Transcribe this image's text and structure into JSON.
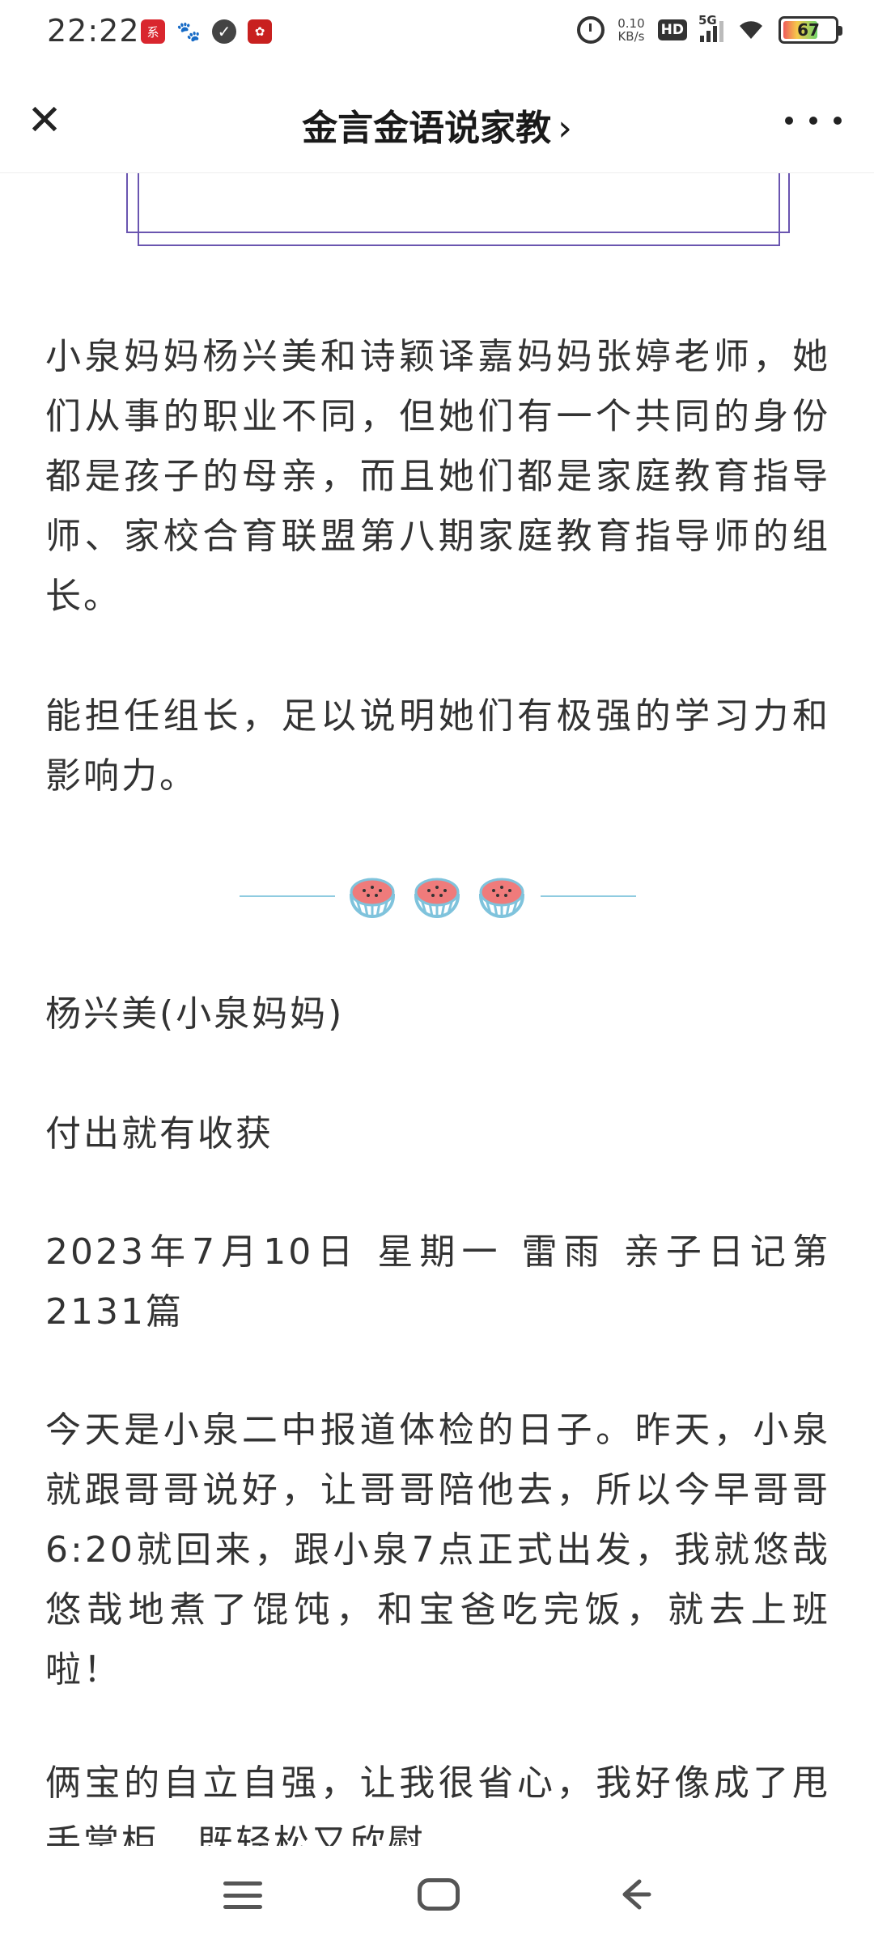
{
  "status_bar": {
    "time": "22:22",
    "app_icons": [
      {
        "name": "news-app-icon",
        "glyph": "系"
      },
      {
        "name": "baidu-icon",
        "glyph": "🐾"
      },
      {
        "name": "check-icon",
        "glyph": "✓"
      },
      {
        "name": "red-app-icon",
        "glyph": "✿"
      }
    ],
    "network_speed": "0.10",
    "network_speed_unit": "KB/s",
    "hd": "HD",
    "network_type": "5G",
    "battery": "67",
    "battery_level": 0.67
  },
  "nav": {
    "title": "金言金语说家教",
    "title_chevron": "›",
    "close_glyph": "✕"
  },
  "article": {
    "paragraphs": [
      "小泉妈妈杨兴美和诗颖译嘉妈妈张婷老师，她们从事的职业不同，但她们有一个共同的身份都是孩子的母亲，而且她们都是家庭教育指导师、家校合育联盟第八期家庭教育指导师的组长。",
      "能担任组长，足以说明她们有极强的学习力和影响力。",
      "杨兴美(小泉妈妈)",
      "付出就有收获",
      "2023年7月10日 星期一 雷雨 亲子日记第2131篇",
      "今天是小泉二中报道体检的日子。昨天，小泉就跟哥哥说好，让哥哥陪他去，所以今早哥哥6:20就回来，跟小泉7点正式出发，我就悠哉悠哉地煮了馄饨，和宝爸吃完饭，就去上班啦！",
      "俩宝的自立自强，让我很省心，我好像成了甩手掌柜，既轻松又欣慰。"
    ]
  },
  "colors": {
    "frame": "#6a55b0",
    "divider_line": "#8fcbe0",
    "melon_flesh": "#ef7b7b",
    "melon_rind": "#7fc3dc"
  }
}
